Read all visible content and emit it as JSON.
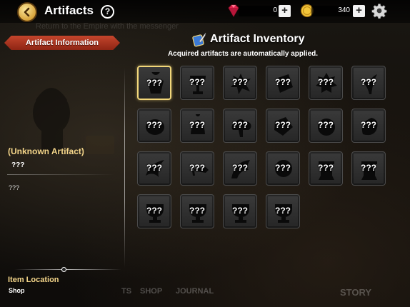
{
  "header": {
    "title": "Artifacts",
    "help_label": "?",
    "gems": "0",
    "gold": "340",
    "plus_label": "+"
  },
  "background": {
    "quest_text": "Return to the Empire with the messenger",
    "nav_partial": "TS",
    "nav_shop": "SHOP",
    "nav_journal": "JOURNAL",
    "nav_story": "STORY"
  },
  "info_panel": {
    "banner": "Artifact Information",
    "name": "(Unknown Artifact)",
    "subname": "???",
    "description": "???",
    "location_title": "Item Location",
    "location_value": "Shop"
  },
  "inventory": {
    "title": "Artifact Inventory",
    "subtitle": "Acquired artifacts are automatically applied.",
    "selected_index": 0,
    "slots": [
      {
        "label": "???",
        "icon": "angel-silhouette"
      },
      {
        "label": "???",
        "icon": "chalice-silhouette"
      },
      {
        "label": "???",
        "icon": "splash-silhouette"
      },
      {
        "label": "???",
        "icon": "scroll-silhouette"
      },
      {
        "label": "???",
        "icon": "gear-silhouette"
      },
      {
        "label": "???",
        "icon": "plant-silhouette"
      },
      {
        "label": "???",
        "icon": "blob-silhouette"
      },
      {
        "label": "???",
        "icon": "bell-silhouette"
      },
      {
        "label": "???",
        "icon": "cloud-silhouette"
      },
      {
        "label": "???",
        "icon": "gem-silhouette"
      },
      {
        "label": "???",
        "icon": "round-silhouette"
      },
      {
        "label": "???",
        "icon": "egg-silhouette"
      },
      {
        "label": "???",
        "icon": "horn-silhouette"
      },
      {
        "label": "???",
        "icon": "sword-silhouette"
      },
      {
        "label": "???",
        "icon": "wing-silhouette"
      },
      {
        "label": "???",
        "icon": "orb-silhouette"
      },
      {
        "label": "???",
        "icon": "pot-silhouette"
      },
      {
        "label": "???",
        "icon": "pot-silhouette"
      },
      {
        "label": "???",
        "icon": "cup-silhouette"
      },
      {
        "label": "???",
        "icon": "cup-silhouette"
      },
      {
        "label": "???",
        "icon": "cup-silhouette"
      },
      {
        "label": "???",
        "icon": "cup-silhouette"
      }
    ]
  },
  "colors": {
    "accent_gold": "#f5d68a",
    "banner_red": "#b23a22",
    "selected_border": "#f2d77a"
  }
}
